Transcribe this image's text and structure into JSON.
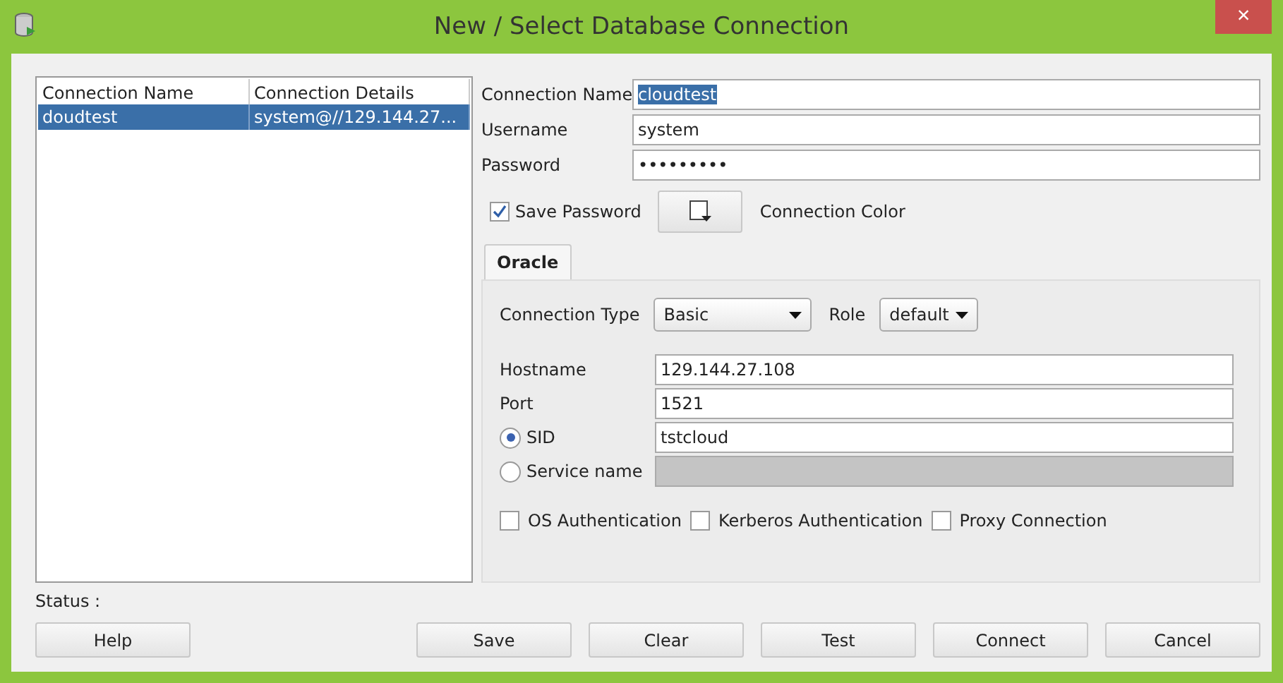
{
  "window": {
    "title": "New / Select Database Connection",
    "close": "×"
  },
  "connections": {
    "columns": [
      "Connection Name",
      "Connection Details"
    ],
    "rows": [
      {
        "cells": [
          "doudtest",
          "system@//129.144.27..."
        ],
        "selected": true
      }
    ]
  },
  "fields": [
    {
      "label": "Connection Name",
      "value": "cloudtest",
      "text_selected": true
    },
    {
      "label": "Username",
      "value": "system",
      "text_selected": false
    },
    {
      "label": "Password",
      "value": "•••••••••",
      "text_selected": false
    }
  ],
  "save_password": {
    "label": "Save Password",
    "checked": true
  },
  "connection_color": {
    "label": "Connection Color"
  },
  "tabs": [
    {
      "label": "Oracle",
      "selected": true
    }
  ],
  "connection_type": {
    "label": "Connection Type",
    "value": "Basic"
  },
  "role": {
    "label": "Role",
    "value": "default"
  },
  "host_fields": [
    {
      "label": "Hostname",
      "value": "129.144.27.108"
    },
    {
      "label": "Port",
      "value": "1521"
    }
  ],
  "identifier_options": [
    {
      "label": "SID",
      "value": "tstcloud",
      "selected": true,
      "disabled": false
    },
    {
      "label": "Service name",
      "selected": false,
      "disabled": true
    }
  ],
  "auth_options": [
    {
      "label": "OS Authentication",
      "checked": false
    },
    {
      "label": "Kerberos Authentication",
      "checked": false
    },
    {
      "label": "Proxy Connection",
      "checked": false
    }
  ],
  "status": {
    "label": "Status :"
  },
  "help_button": {
    "label": "Help"
  },
  "buttons": [
    {
      "label": "Save"
    },
    {
      "label": "Clear"
    },
    {
      "label": "Test"
    },
    {
      "label": "Connect"
    },
    {
      "label": "Cancel"
    }
  ]
}
